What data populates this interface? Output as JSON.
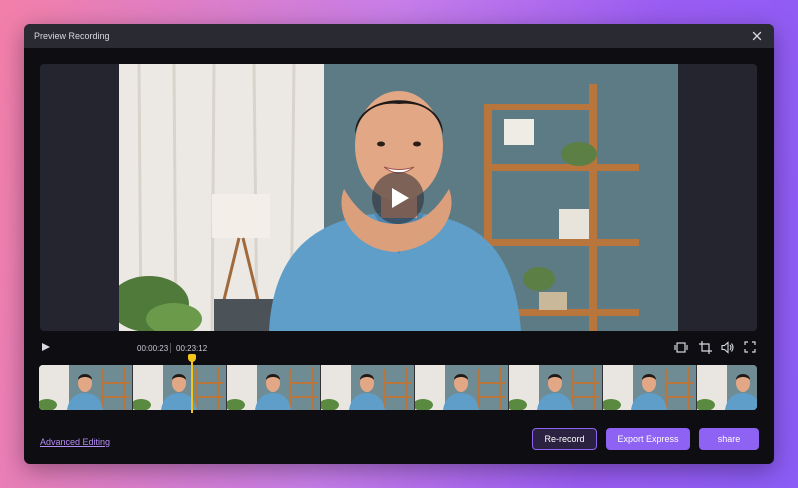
{
  "window": {
    "title": "Preview Recording"
  },
  "player": {
    "current_time": "00:00:23",
    "total_time": "00:23:12"
  },
  "timeline": {
    "thumbnail_count": 8
  },
  "footer": {
    "advanced_link": "Advanced Editing",
    "rerecord_label": "Re-record",
    "export_label": "Export Express",
    "share_label": "share"
  },
  "colors": {
    "accent": "#8e62f2",
    "playhead": "#f5c518",
    "window_bg": "#0d0d12",
    "titlebar_bg": "#2a2a33"
  },
  "icons": {
    "close": "close-icon",
    "play": "play-icon",
    "aspect": "aspect-ratio-icon",
    "crop": "crop-icon",
    "volume": "volume-icon",
    "fullscreen": "fullscreen-icon"
  }
}
